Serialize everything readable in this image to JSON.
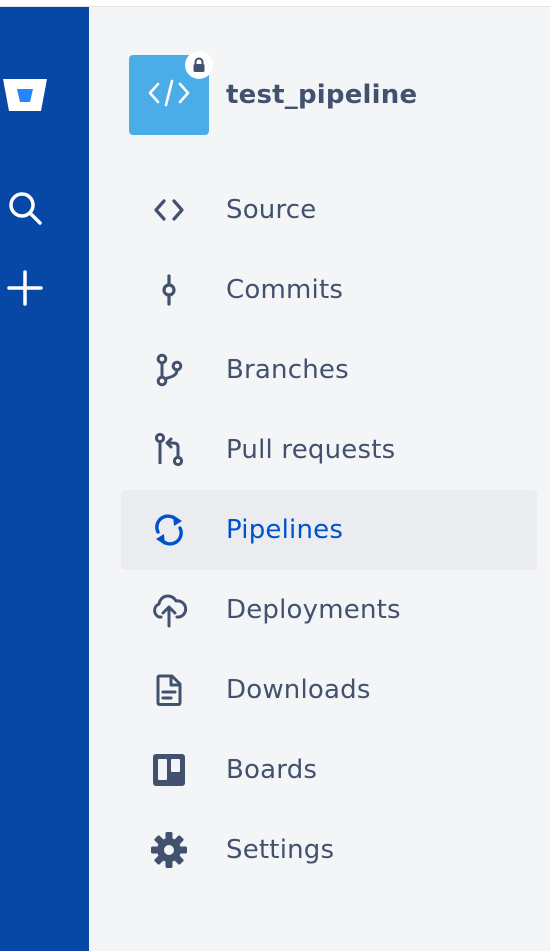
{
  "global_nav": {
    "logo_icon": "bitbucket-logo-icon",
    "search_icon": "search-icon",
    "create_icon": "plus-icon"
  },
  "repo": {
    "name": "test_pipeline",
    "avatar_icon": "code-brackets-icon",
    "private_icon": "lock-icon"
  },
  "nav": {
    "items": [
      {
        "label": "Source",
        "icon": "code-icon"
      },
      {
        "label": "Commits",
        "icon": "commit-icon"
      },
      {
        "label": "Branches",
        "icon": "branch-icon"
      },
      {
        "label": "Pull requests",
        "icon": "pull-request-icon"
      },
      {
        "label": "Pipelines",
        "icon": "refresh-cycle-icon",
        "active": true
      },
      {
        "label": "Deployments",
        "icon": "cloud-upload-icon"
      },
      {
        "label": "Downloads",
        "icon": "document-icon"
      },
      {
        "label": "Boards",
        "icon": "board-icon"
      },
      {
        "label": "Settings",
        "icon": "gear-icon"
      }
    ]
  },
  "colors": {
    "global_nav_bg": "#0747a6",
    "sidebar_bg": "#f4f5f7",
    "active_text": "#0052cc",
    "text": "#42526e",
    "repo_avatar_bg": "#4bade8"
  }
}
